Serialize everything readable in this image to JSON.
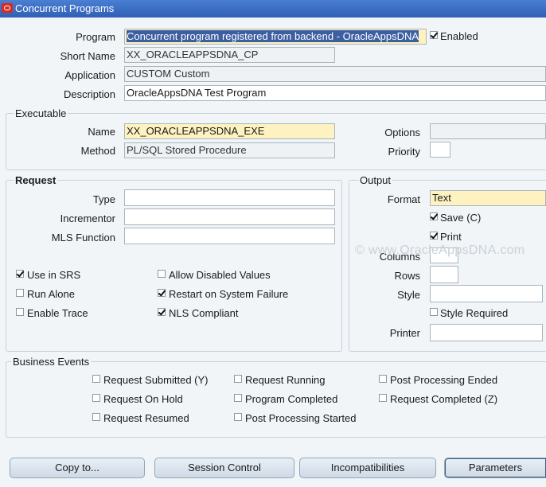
{
  "window": {
    "title": "Concurrent Programs"
  },
  "program": {
    "program_label": "Program",
    "program_value": "Concurrent program registered from backend - OracleAppsDNA",
    "enabled_label": "Enabled",
    "enabled": true,
    "short_name_label": "Short Name",
    "short_name_value": "XX_ORACLEAPPSDNA_CP",
    "application_label": "Application",
    "application_value": "CUSTOM Custom",
    "description_label": "Description",
    "description_value": "OracleAppsDNA Test Program"
  },
  "executable": {
    "title": "Executable",
    "name_label": "Name",
    "name_value": "XX_ORACLEAPPSDNA_EXE",
    "method_label": "Method",
    "method_value": "PL/SQL Stored Procedure",
    "options_label": "Options",
    "options_value": "",
    "priority_label": "Priority",
    "priority_value": ""
  },
  "request": {
    "title": "Request",
    "type_label": "Type",
    "incrementor_label": "Incrementor",
    "mls_label": "MLS Function",
    "checkboxes": [
      {
        "label": "Use in SRS",
        "checked": true
      },
      {
        "label": "Run Alone",
        "checked": false
      },
      {
        "label": "Enable Trace",
        "checked": false
      },
      {
        "label": "Allow Disabled Values",
        "checked": false
      },
      {
        "label": "Restart on System Failure",
        "checked": true
      },
      {
        "label": "NLS Compliant",
        "checked": true
      }
    ]
  },
  "output": {
    "title": "Output",
    "format_label": "Format",
    "format_value": "Text",
    "save_label": "Save (C)",
    "save": true,
    "print_label": "Print",
    "print": true,
    "columns_label": "Columns",
    "rows_label": "Rows",
    "style_label": "Style",
    "style_required_label": "Style Required",
    "style_required": false,
    "printer_label": "Printer"
  },
  "business_events": {
    "title": "Business Events",
    "items": [
      "Request Submitted (Y)",
      "Request On Hold",
      "Request Resumed",
      "Request Running",
      "Program Completed",
      "Post Processing Started",
      "Post Processing Ended",
      "Request Completed (Z)"
    ]
  },
  "buttons": {
    "copy": "Copy to...",
    "session": "Session Control",
    "incompat": "Incompatibilities",
    "params": "Parameters"
  },
  "watermark": "© www.OracleAppsDNA.com"
}
